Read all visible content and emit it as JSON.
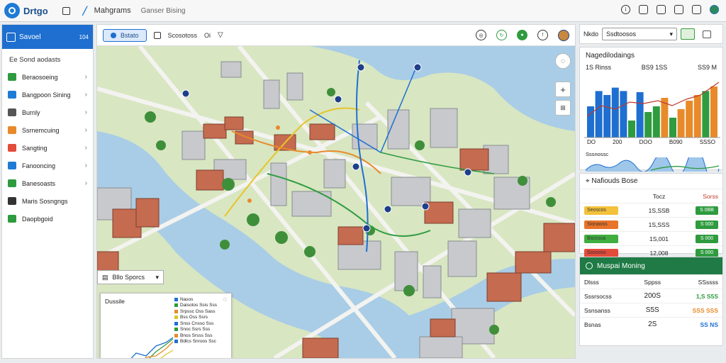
{
  "app": {
    "brand": "Drtgo",
    "title": "Mahgrams",
    "subtitle": "Ganser Bising"
  },
  "sidebar": {
    "header": "Savoel",
    "header_num": "104",
    "section": "Ee Sond aodasts",
    "items": [
      {
        "label": "Beraosoeing",
        "color": "#2e9b3f"
      },
      {
        "label": "Bangpoon Sining",
        "color": "#1e7bd6"
      },
      {
        "label": "Burnly",
        "color": "#555555"
      },
      {
        "label": "Ssrnemcuing",
        "color": "#e88a2a"
      },
      {
        "label": "Sangting",
        "color": "#e34b3b"
      },
      {
        "label": "Fanooncing",
        "color": "#1e7bd6"
      },
      {
        "label": "Banesoasts",
        "color": "#2e9b3f"
      },
      {
        "label": "Maris Sosngngs",
        "color": "#333333"
      },
      {
        "label": "Daopbgoid",
        "color": "#2e9b3f"
      }
    ]
  },
  "map_toolbar": {
    "button": "Bstato",
    "label": "Scosotoss",
    "label2": "Oi"
  },
  "map": {
    "dropdown": "Bllo Sporcs",
    "overlay_title": "Dussile",
    "legend": [
      {
        "label": "Nasos",
        "color": "#1e6fd0"
      },
      {
        "label": "Daisotos Ssis Sss",
        "color": "#2e9b3f"
      },
      {
        "label": "Srpssc Oss Sass",
        "color": "#e88a2a"
      },
      {
        "label": "Bss Oss Ssrs",
        "color": "#d8c52a"
      },
      {
        "label": "Snss Cnsso Sss",
        "color": "#1e6fd0"
      },
      {
        "label": "Snoc Ssrs Sss",
        "color": "#2e9b3f"
      },
      {
        "label": "Bnos Srsss Sss",
        "color": "#e88a2a"
      },
      {
        "label": "Bdlcs Snroos Ssc",
        "color": "#1e6fd0"
      }
    ]
  },
  "right": {
    "select_label": "Nkdo",
    "select_value": "Ssdtoosos",
    "card1": {
      "title": "Nagedilodaings",
      "kpis": [
        "1S Rinss",
        "BS9 1SS",
        "SS9 M"
      ],
      "xlabels": [
        "DO",
        "200",
        "DOO",
        "B090",
        "SSSO"
      ],
      "sub": "Sssnossc"
    },
    "card2": {
      "title": "Nafiouds Bose",
      "col2": "Tocz",
      "col3": "Sorss",
      "rows": [
        {
          "name": "Seoscos",
          "value": "1S,SSB",
          "badge": "S 0BB",
          "color": "#f3c13a"
        },
        {
          "name": "Sionaoss",
          "value": "1S,SSS",
          "badge": "S 000",
          "color": "#e8732a"
        },
        {
          "name": "Bsccsca",
          "value": "1S,001",
          "badge": "S 000",
          "color": "#3fae3f"
        },
        {
          "name": "Sosooss",
          "value": "12,008",
          "badge": "S 000",
          "color": "#e34b3b"
        }
      ]
    },
    "card3": {
      "title": "Muspai Moning",
      "col1": "Dlsss",
      "col2": "Sppss",
      "col3": "SSssss",
      "rows": [
        {
          "name": "Sssrsocss",
          "value": "200S",
          "amount": "1,S S5S"
        },
        {
          "name": "Ssnsanss",
          "value": "S5S",
          "amount": "SSS SSS"
        },
        {
          "name": "Bsnas",
          "value": "2S",
          "amount": "SS NS"
        }
      ]
    }
  }
}
